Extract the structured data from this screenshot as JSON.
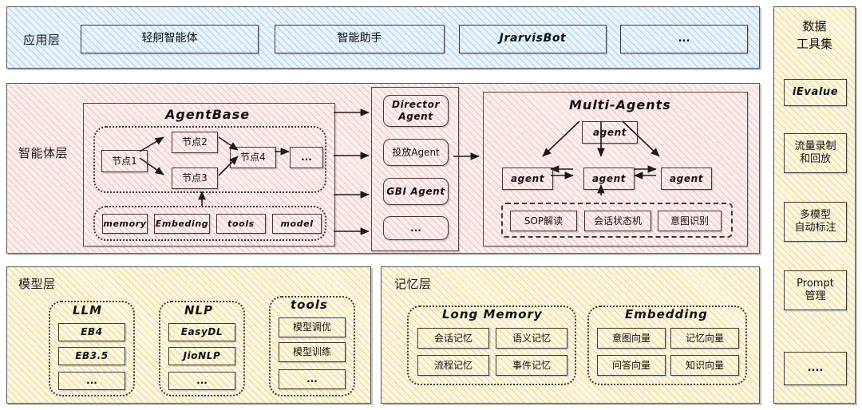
{
  "app_layer": {
    "label": "应用层",
    "items": [
      {
        "label": "轻舸智能体"
      },
      {
        "label": "智能助手"
      },
      {
        "label": "JrarvisBot"
      },
      {
        "label": "..."
      }
    ]
  },
  "agent_layer": {
    "label": "智能体层",
    "agent_base": {
      "title": "AgentBase",
      "nodes": [
        {
          "label": "节点1"
        },
        {
          "label": "节点2"
        },
        {
          "label": "节点3"
        },
        {
          "label": "节点4"
        },
        {
          "label": "..."
        }
      ],
      "resources": [
        {
          "label": "memory"
        },
        {
          "label": "Embeding"
        },
        {
          "label": "tools"
        },
        {
          "label": "model"
        }
      ]
    },
    "agents": [
      {
        "label": "Director Agent"
      },
      {
        "label": "投放Agent"
      },
      {
        "label": "GBI Agent"
      },
      {
        "label": "..."
      }
    ],
    "multi_agents": {
      "title": "Multi-Agents",
      "nodes": [
        {
          "label": "agent"
        },
        {
          "label": "agent"
        },
        {
          "label": "agent"
        },
        {
          "label": "agent"
        }
      ],
      "capabilities": [
        {
          "label": "SOP解读"
        },
        {
          "label": "会话状态机"
        },
        {
          "label": "意图识别"
        }
      ]
    }
  },
  "model_layer": {
    "label": "模型层",
    "groups": [
      {
        "title": "LLM",
        "items": [
          {
            "label": "EB4"
          },
          {
            "label": "EB3.5"
          },
          {
            "label": "..."
          }
        ]
      },
      {
        "title": "NLP",
        "items": [
          {
            "label": "EasyDL"
          },
          {
            "label": "JioNLP"
          },
          {
            "label": "..."
          }
        ]
      },
      {
        "title": "tools",
        "items": [
          {
            "label": "模型调优"
          },
          {
            "label": "模型训练"
          },
          {
            "label": "..."
          }
        ]
      }
    ]
  },
  "memory_layer": {
    "label": "记忆层",
    "groups": [
      {
        "title": "Long Memory",
        "items": [
          {
            "label": "会话记忆"
          },
          {
            "label": "语义记忆"
          },
          {
            "label": "流程记忆"
          },
          {
            "label": "事件记忆"
          }
        ]
      },
      {
        "title": "Embedding",
        "items": [
          {
            "label": "意图向量"
          },
          {
            "label": "记忆向量"
          },
          {
            "label": "问答向量"
          },
          {
            "label": "知识向量"
          }
        ]
      }
    ]
  },
  "data_tools": {
    "title_line1": "数据",
    "title_line2": "工具集",
    "items": [
      {
        "label": "iEvalue"
      },
      {
        "label": "流量录制\n和回放"
      },
      {
        "label": "多模型\n自动标注"
      },
      {
        "label": "Prompt\n管理"
      },
      {
        "label": "...."
      }
    ]
  },
  "colors": {
    "app_layer": "#e8f3fb",
    "agent_layer": "#fdeeee",
    "model_layer": "#fdf6e0",
    "memory_layer": "#fdf6e0",
    "data_tools": "#fdf6e0",
    "stroke": "#3a3a3a"
  }
}
